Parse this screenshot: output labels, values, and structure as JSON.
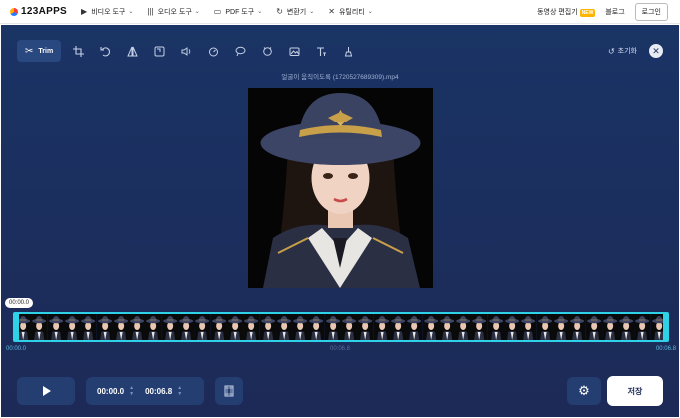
{
  "nav": {
    "logo": "123APPS",
    "items": [
      {
        "label": "비디오 도구",
        "icon": "video-icon"
      },
      {
        "label": "오디오 도구",
        "icon": "audio-icon"
      },
      {
        "label": "PDF 도구",
        "icon": "pdf-icon"
      },
      {
        "label": "변환기",
        "icon": "convert-icon"
      },
      {
        "label": "유틸리티",
        "icon": "tools-icon"
      }
    ],
    "editor_link": "동영상 편집기",
    "new_badge": "NEW",
    "blog": "블로그",
    "login": "로그인"
  },
  "toolbar": {
    "active_label": "Trim",
    "tools": [
      "crop-icon",
      "rotate-icon",
      "flip-icon",
      "resize-icon",
      "volume-icon",
      "speed-icon",
      "loop-icon",
      "stabilize-icon",
      "image-icon",
      "text-icon",
      "watermark-icon"
    ],
    "reset_label": "초기화"
  },
  "filename": "얼굴이 움직이도록 (1720527689309).mp4",
  "timeline": {
    "current_tag": "00:00.0",
    "start_label": "00:00.0",
    "mid_label": "00:06.8",
    "end_label": "00:06.8",
    "thumb_count": 40
  },
  "controls": {
    "start_value": "00:00.0",
    "end_value": "00:06.8",
    "save_label": "저장"
  },
  "colors": {
    "accent": "#2fd1e6",
    "panel": "#243e72",
    "background": "#1b2f5e"
  }
}
